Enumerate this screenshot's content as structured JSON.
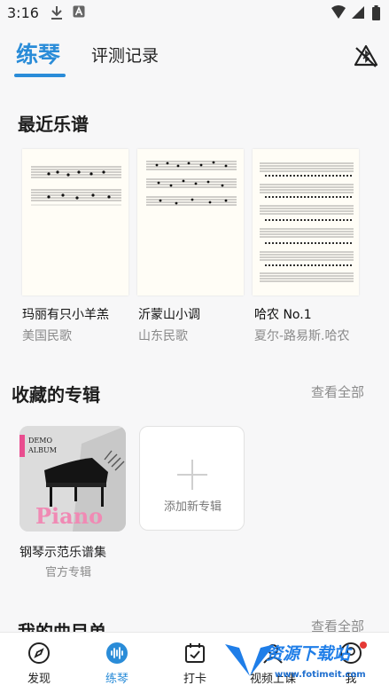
{
  "status_bar": {
    "time": "3:16"
  },
  "header": {
    "tab_active": "练琴",
    "tab_inactive": "评测记录"
  },
  "recent": {
    "title": "最近乐谱",
    "items": [
      {
        "title": "玛丽有只小羊羔",
        "subtitle": "美国民歌"
      },
      {
        "title": "沂蒙山小调",
        "subtitle": "山东民歌"
      },
      {
        "title": "哈农 No.1",
        "subtitle": "夏尔-路易斯.哈农"
      }
    ]
  },
  "albums": {
    "title": "收藏的专辑",
    "view_all": "查看全部",
    "cover": {
      "tag_line1": "DEMO",
      "tag_line2": "ALBUM",
      "word": "Piano"
    },
    "items": [
      {
        "title": "钢琴示范乐谱集",
        "subtitle": "官方专辑"
      }
    ],
    "add_label": "添加新专辑"
  },
  "my_list": {
    "title": "我的曲目单",
    "view_all": "查看全部"
  },
  "nav": [
    {
      "label": "发现",
      "icon": "compass-icon",
      "active": false
    },
    {
      "label": "练琴",
      "icon": "waveform-icon",
      "active": true
    },
    {
      "label": "打卡",
      "icon": "calendar-check-icon",
      "active": false
    },
    {
      "label": "视频上课",
      "icon": "video-lesson-icon",
      "active": false
    },
    {
      "label": "我",
      "icon": "profile-icon",
      "active": false
    }
  ],
  "watermark": {
    "text": "资源下载站",
    "url": "www.fotimeit.com"
  },
  "colors": {
    "accent": "#2a8cd8",
    "badge": "#e53935",
    "cover_pink": "#e94d8f"
  }
}
